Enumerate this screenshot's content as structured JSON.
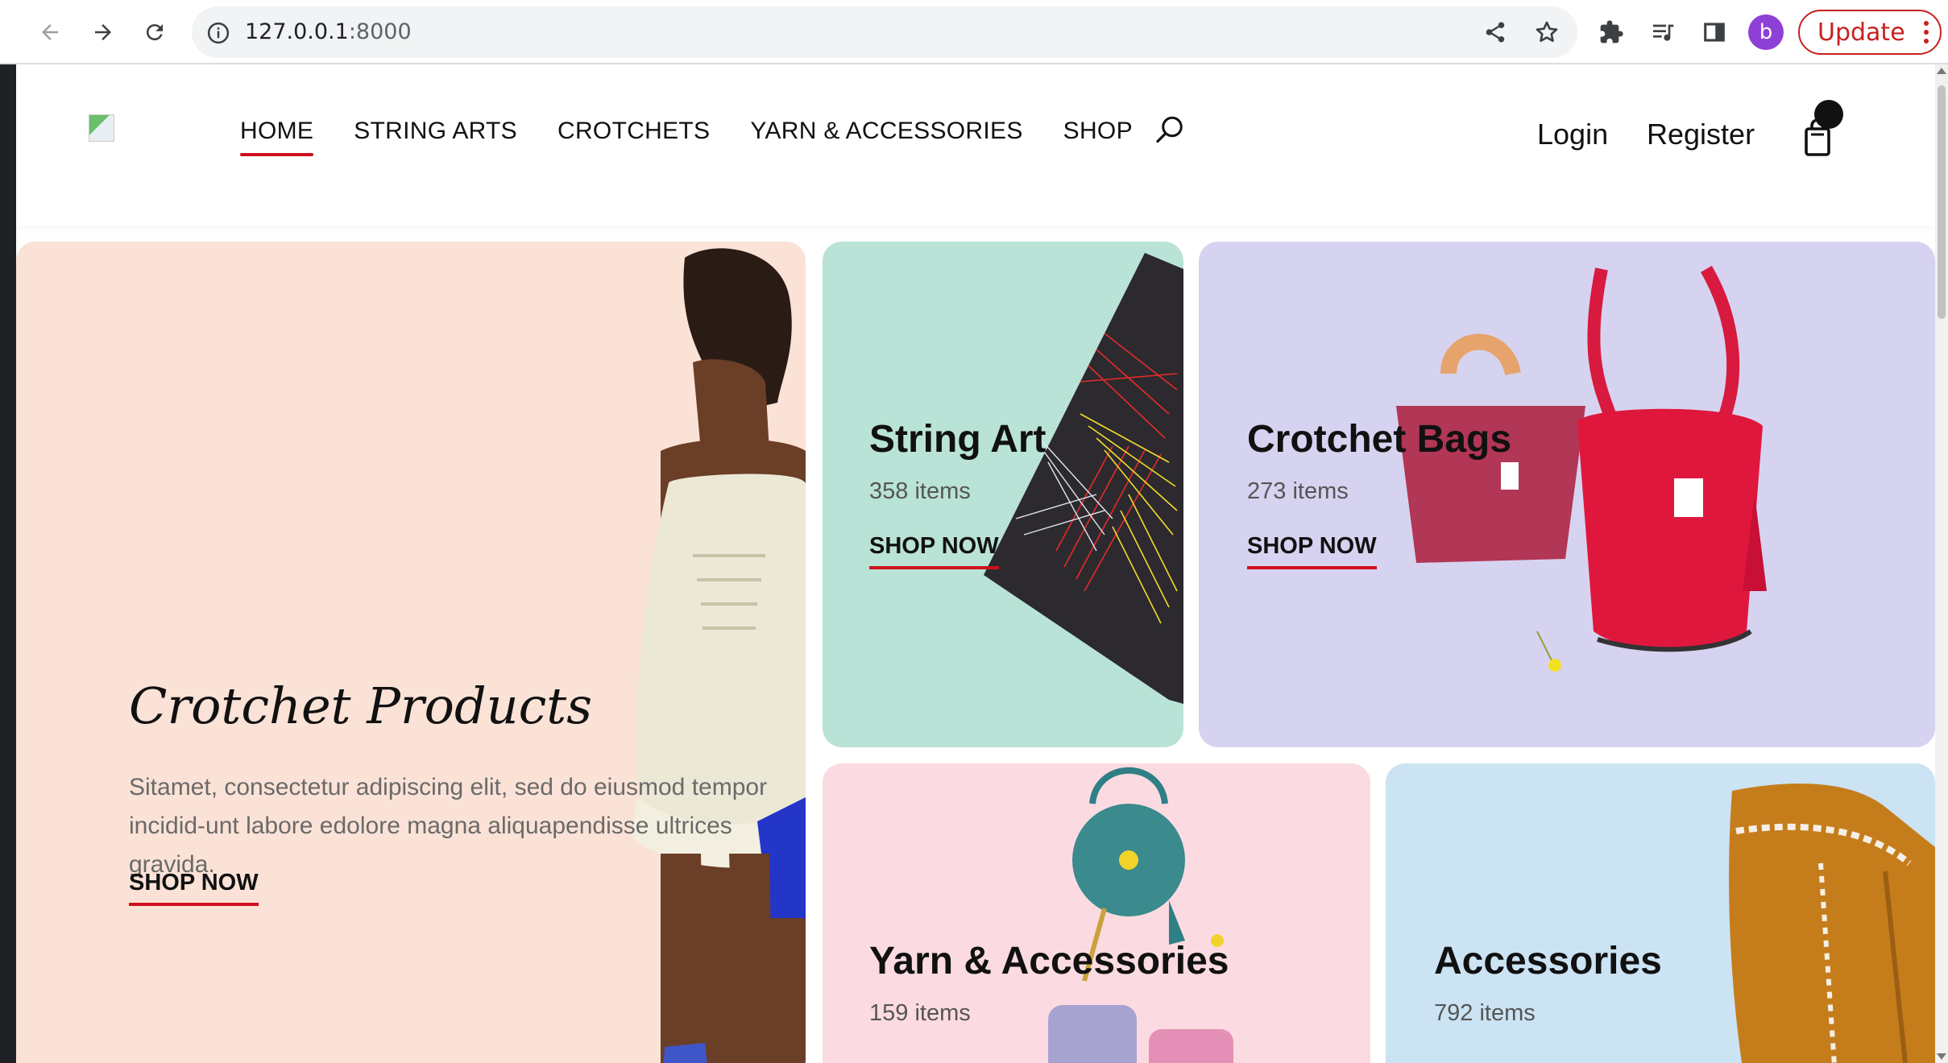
{
  "browser": {
    "url_host": "127.0.0.1",
    "url_port": ":8000",
    "profile_initial": "b",
    "update_label": "Update"
  },
  "header": {
    "nav": [
      {
        "label": "HOME",
        "active": true
      },
      {
        "label": "STRING ARTS"
      },
      {
        "label": "CROTCHETS"
      },
      {
        "label": "YARN & ACCESSORIES"
      },
      {
        "label": "SHOP"
      }
    ],
    "login_label": "Login",
    "register_label": "Register"
  },
  "hero": {
    "title": "Crotchet Products",
    "description": "Sitamet, consectetur adipiscing elit, sed do eiusmod tempor incidid-unt labore edolore magna aliquapendisse ultrices gravida.",
    "cta": "SHOP NOW"
  },
  "categories": [
    {
      "title": "String Art",
      "count": "358 items",
      "cta": "SHOP NOW"
    },
    {
      "title": "Crotchet Bags",
      "count": "273 items",
      "cta": "SHOP NOW"
    },
    {
      "title": "Yarn & Accessories",
      "count": "159 items"
    },
    {
      "title": "Accessories",
      "count": "792 items"
    }
  ],
  "colors": {
    "accent": "#d0101b",
    "hero_bg": "#fbe2d6",
    "string_bg": "#b9e3d6",
    "bags_bg": "#d6d3f0",
    "yarn_bg": "#fbdbe1",
    "accessories_bg": "#cbe3f3"
  }
}
